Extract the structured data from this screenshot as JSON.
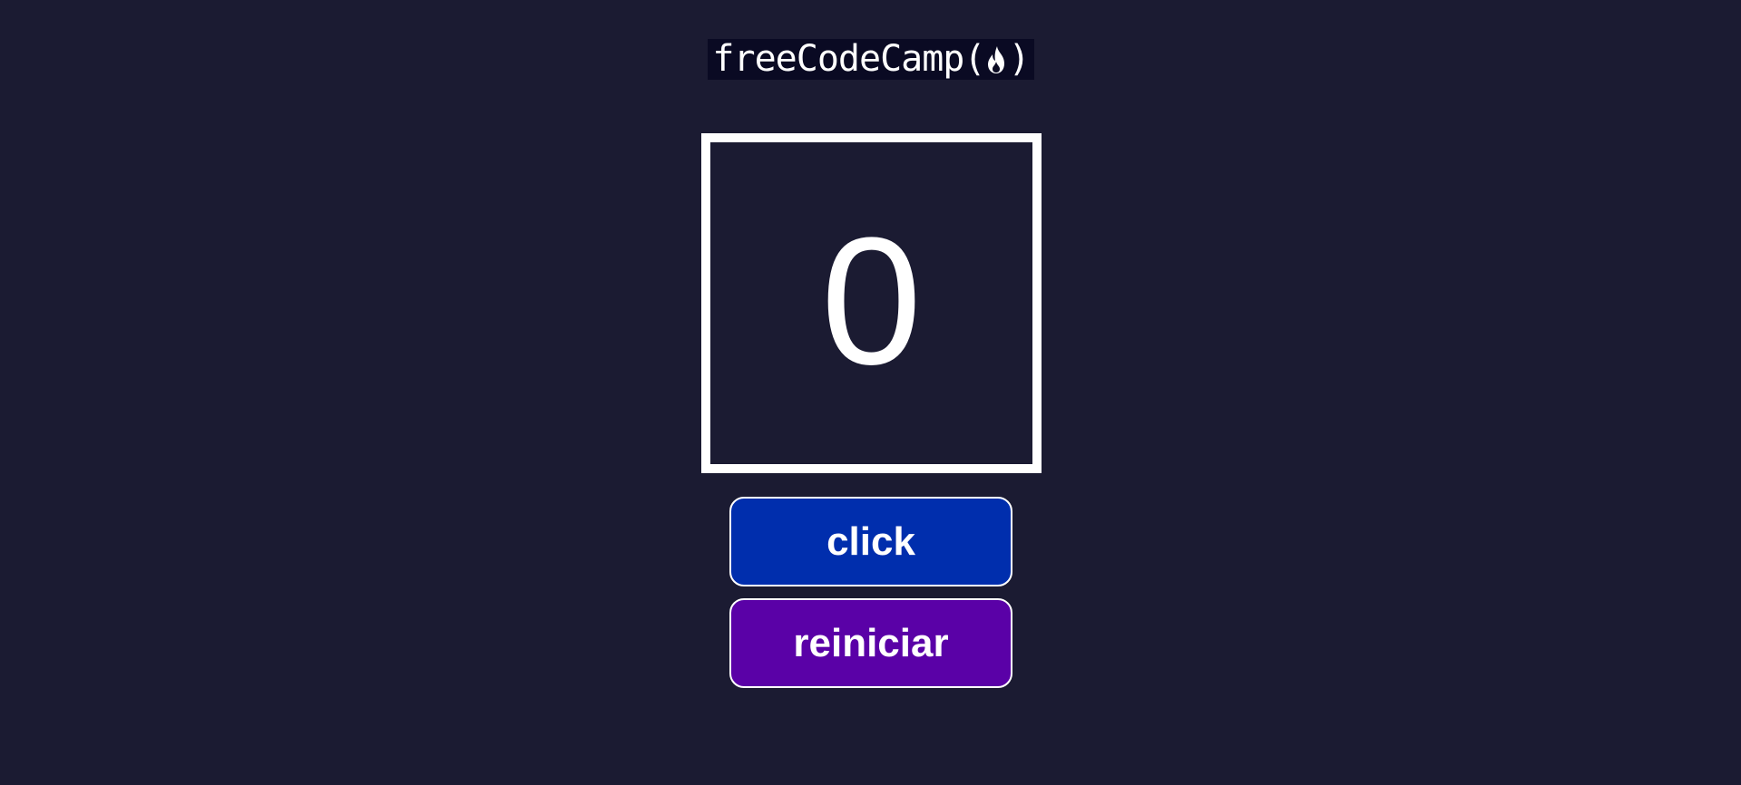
{
  "logo": {
    "text": "freeCodeCamp",
    "open_paren": "(",
    "close_paren": ")",
    "icon": "flame-icon"
  },
  "counter": {
    "value": "0"
  },
  "buttons": {
    "click_label": "click",
    "reset_label": "reiniciar"
  },
  "colors": {
    "background": "#1b1b32",
    "logo_background": "#0a0a23",
    "click_button": "#002ead",
    "reset_button": "#5a01a7",
    "foreground": "#ffffff"
  }
}
